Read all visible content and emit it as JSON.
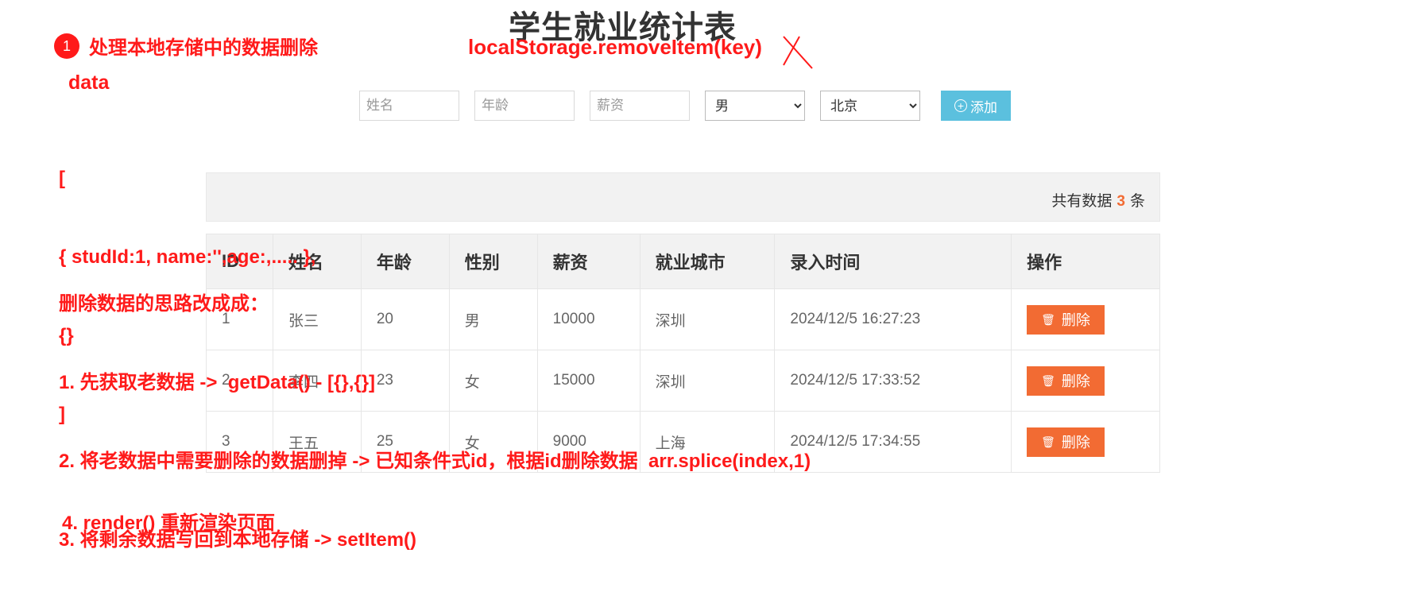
{
  "page": {
    "title": "学生就业统计表"
  },
  "form": {
    "name_placeholder": "姓名",
    "age_placeholder": "年龄",
    "salary_placeholder": "薪资",
    "gender_selected": "男",
    "city_selected": "北京",
    "add_label": "添加"
  },
  "summary": {
    "prefix": "共有数据",
    "count": "3",
    "suffix": "条"
  },
  "table": {
    "headers": [
      "ID",
      "姓名",
      "年龄",
      "性别",
      "薪资",
      "就业城市",
      "录入时间",
      "操作"
    ],
    "rows": [
      {
        "id": "1",
        "name": "张三",
        "age": "20",
        "gender": "男",
        "salary": "10000",
        "city": "深圳",
        "time": "2024/12/5 16:27:23",
        "action": "删除"
      },
      {
        "id": "2",
        "name": "李四",
        "age": "23",
        "gender": "女",
        "salary": "15000",
        "city": "深圳",
        "time": "2024/12/5 17:33:52",
        "action": "删除"
      },
      {
        "id": "3",
        "name": "王五",
        "age": "25",
        "gender": "女",
        "salary": "9000",
        "city": "上海",
        "time": "2024/12/5 17:34:55",
        "action": "删除"
      }
    ]
  },
  "annotations": {
    "step_number": "1",
    "heading": "处理本地存储中的数据删除",
    "api": "localStorage.removeItem(key)",
    "data_label": "data",
    "code_lines": [
      "[",
      "{ studId:1, name:'',age:,..... },",
      "{}",
      "]"
    ],
    "steps_title": "删除数据的思路改成成：",
    "steps": [
      "1. 先获取老数据 ->  getData() - [{},{}]",
      "2. 将老数据中需要删除的数据删掉 -> 已知条件式id，根据id删除数据  arr.splice(index,1)",
      "3. 将剩余数据写回到本地存储 -> setItem()"
    ],
    "render_step": "4. render() 重新渲染页面",
    "color": "#ff1a1a"
  },
  "colors": {
    "accent_orange": "#f26b33",
    "add_button": "#5bc0de",
    "header_bg": "#f2f2f2"
  }
}
